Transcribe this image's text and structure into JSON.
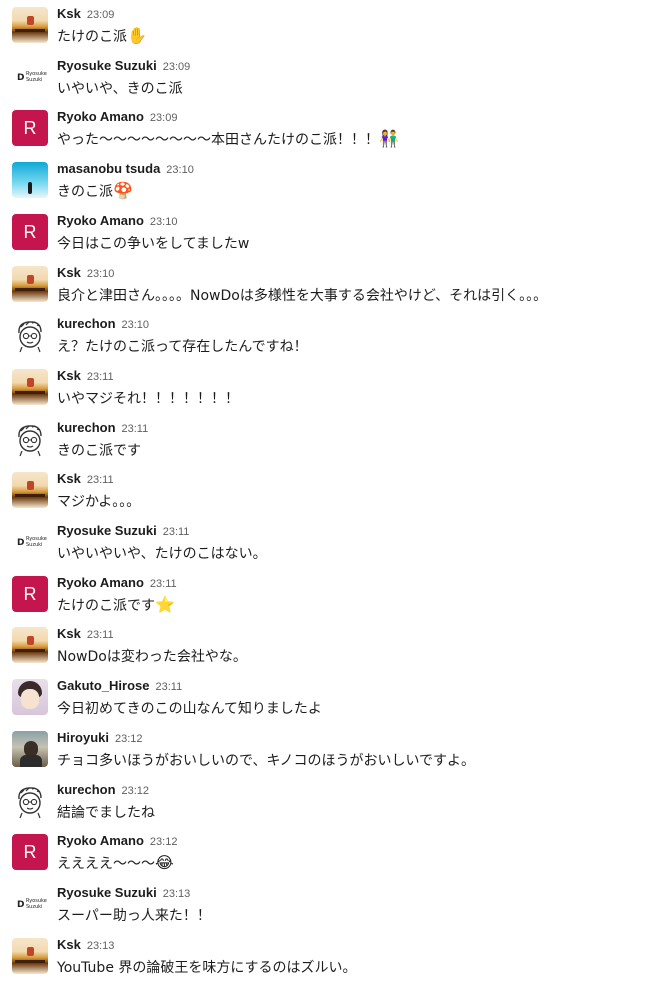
{
  "messages": [
    {
      "avatar": "ksk",
      "name": "Ksk",
      "time": "23:09",
      "text": "たけのこ派",
      "emoji": "✋"
    },
    {
      "avatar": "ryosuke",
      "name": "Ryosuke Suzuki",
      "time": "23:09",
      "text": "いやいや、きのこ派",
      "emoji": ""
    },
    {
      "avatar": "ryoko",
      "avatar_letter": "R",
      "name": "Ryoko Amano",
      "time": "23:09",
      "text": "やった〜〜〜〜〜〜〜〜本田さんたけのこ派！！！",
      "emoji": "👫"
    },
    {
      "avatar": "masa",
      "name": "masanobu tsuda",
      "time": "23:10",
      "text": "きのこ派",
      "emoji": "🍄"
    },
    {
      "avatar": "ryoko",
      "avatar_letter": "R",
      "name": "Ryoko Amano",
      "time": "23:10",
      "text": "今日はこの争いをしてましたw",
      "emoji": ""
    },
    {
      "avatar": "ksk",
      "name": "Ksk",
      "time": "23:10",
      "text": "良介と津田さん。。。。NowDoは多様性を大事する会社やけど、それは引く。。。",
      "emoji": ""
    },
    {
      "avatar": "kure",
      "name": "kurechon",
      "time": "23:10",
      "text": "え？たけのこ派って存在したんですね！",
      "emoji": ""
    },
    {
      "avatar": "ksk",
      "name": "Ksk",
      "time": "23:11",
      "text": "いやマジそれ！！！！！！！",
      "emoji": ""
    },
    {
      "avatar": "kure",
      "name": "kurechon",
      "time": "23:11",
      "text": "きのこ派です",
      "emoji": ""
    },
    {
      "avatar": "ksk",
      "name": "Ksk",
      "time": "23:11",
      "text": "マジかよ。。。",
      "emoji": ""
    },
    {
      "avatar": "ryosuke",
      "name": "Ryosuke Suzuki",
      "time": "23:11",
      "text": "いやいやいや、たけのこはない。",
      "emoji": ""
    },
    {
      "avatar": "ryoko",
      "avatar_letter": "R",
      "name": "Ryoko Amano",
      "time": "23:11",
      "text": "たけのこ派です",
      "emoji": "⭐"
    },
    {
      "avatar": "ksk",
      "name": "Ksk",
      "time": "23:11",
      "text": "NowDoは変わった会社やな。",
      "emoji": ""
    },
    {
      "avatar": "gaku",
      "name": "Gakuto_Hirose",
      "time": "23:11",
      "text": "今日初めてきのこの山なんて知りましたよ",
      "emoji": ""
    },
    {
      "avatar": "hiro",
      "name": "Hiroyuki",
      "time": "23:12",
      "text": "チョコ多いほうがおいしいので、キノコのほうがおいしいですよ。",
      "emoji": ""
    },
    {
      "avatar": "kure",
      "name": "kurechon",
      "time": "23:12",
      "text": "結論でましたね",
      "emoji": ""
    },
    {
      "avatar": "ryoko",
      "avatar_letter": "R",
      "name": "Ryoko Amano",
      "time": "23:12",
      "text": "ええええ〜〜〜",
      "emoji": "😂"
    },
    {
      "avatar": "ryosuke",
      "name": "Ryosuke Suzuki",
      "time": "23:13",
      "text": "スーパー助っ人来た！！",
      "emoji": ""
    },
    {
      "avatar": "ksk",
      "name": "Ksk",
      "time": "23:13",
      "text": "YouTube 界の論破王を味方にするのはズルい。",
      "emoji": ""
    }
  ],
  "ryosuke_logo": {
    "mark": "D",
    "line1": "Ryosuke",
    "line2": "Suzuki"
  },
  "colors": {
    "ryoko_avatar": "#c4154f",
    "name": "#1d1c1d",
    "time": "#616061"
  }
}
